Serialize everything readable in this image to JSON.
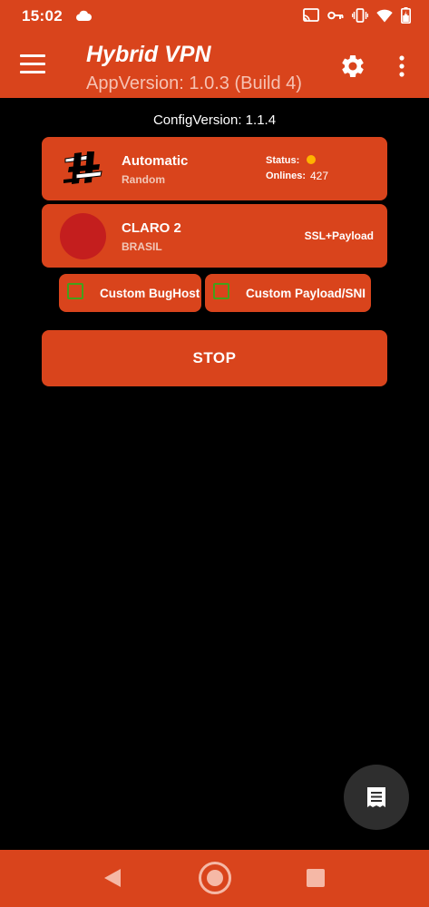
{
  "status_bar": {
    "time": "15:02",
    "icons": [
      "cloud-icon",
      "cast-icon",
      "key-icon",
      "vibrate-icon",
      "wifi-icon",
      "battery-icon"
    ]
  },
  "app_bar": {
    "title": "Hybrid VPN",
    "app_version": "AppVersion: 1.0.3 (Build 4)"
  },
  "config_version": "ConfigVersion: 1.1.4",
  "server_card": {
    "title": "Automatic",
    "subtitle": "Random",
    "status_label": "Status:",
    "status_color": "#ffb300",
    "onlines_label": "Onlines:",
    "onlines_value": "427"
  },
  "network_card": {
    "title": "CLARO 2",
    "subtitle": "BRASIL",
    "type": "SSL+Payload"
  },
  "options": {
    "custom_bughost": "Custom BugHost",
    "custom_payload": "Custom Payload/SNI"
  },
  "stop_button": "STOP",
  "colors": {
    "accent": "#d9441c",
    "background": "#000000",
    "checkbox": "#44a01a",
    "fab": "#2e2e2e"
  }
}
